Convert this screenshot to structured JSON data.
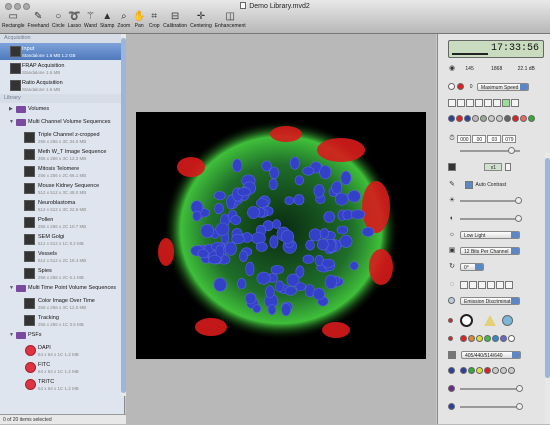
{
  "window": {
    "title": "Demo Library.mvd2"
  },
  "toolbar": [
    {
      "label": "Rectangle",
      "icon": "rectangle-icon"
    },
    {
      "label": "Freehand",
      "icon": "freehand-icon"
    },
    {
      "label": "Circle",
      "icon": "circle-icon"
    },
    {
      "label": "Lasso",
      "icon": "lasso-icon"
    },
    {
      "label": "Wand",
      "icon": "wand-icon"
    },
    {
      "label": "Stamp",
      "icon": "stamp-icon"
    },
    {
      "label": "Zoom",
      "icon": "zoom-icon"
    },
    {
      "label": "Pan",
      "icon": "pan-icon"
    },
    {
      "label": "Crop",
      "icon": "crop-icon"
    },
    {
      "label": "Calibration",
      "icon": "calibration-icon"
    },
    {
      "label": "Centering",
      "icon": "centering-icon"
    },
    {
      "label": "Enhancement",
      "icon": "enhancement-icon"
    }
  ],
  "sidebar": {
    "section_acq": "Acquisition",
    "acq_items": [
      {
        "name": "Input",
        "meta": "Standalone 1.6 MB 1.2 GB"
      },
      {
        "name": "FRAP Acquisition",
        "meta": "Standalone 1.6 MB"
      },
      {
        "name": "Ratio Acquisition",
        "meta": "Standalone 1.6 MB"
      }
    ],
    "section_lib": "Library",
    "groups": [
      {
        "name": "Volumes",
        "items": []
      },
      {
        "name": "Multi Channel Volume Sequences",
        "items": [
          {
            "name": "Triple Channel z-cropped",
            "meta": "256 x 256 x 3C 34.0 MB"
          },
          {
            "name": "Meth W_T Image Sequence",
            "meta": "256 x 256 x 3C 12.2 MB"
          },
          {
            "name": "Mitosis Telomere",
            "meta": "256 x 256 x 2C 66.1 MB"
          },
          {
            "name": "Mouse Kidney Sequence",
            "meta": "512 x 512 x 3C 48.0 MB"
          },
          {
            "name": "Neuroblastoma",
            "meta": "512 x 512 x 3C 22.6 MB"
          },
          {
            "name": "Pollen",
            "meta": "256 x 256 x 2C 10.7 MB"
          },
          {
            "name": "SEM Golgi",
            "meta": "512 x 512 x 1C 8.2 MB"
          },
          {
            "name": "Vessels",
            "meta": "512 x 512 x 2C 18.4 MB"
          },
          {
            "name": "Spies",
            "meta": "256 x 256 x 2C 6.1 MB"
          }
        ]
      },
      {
        "name": "Multi Time Point Volume Sequences",
        "items": [
          {
            "name": "Color Image Over Time",
            "meta": "256 x 256 x 3C 12.0 MB"
          },
          {
            "name": "Tracking",
            "meta": "256 x 256 x 1C 3.5 MB"
          }
        ]
      },
      {
        "name": "PSFs",
        "items": [
          {
            "name": "DAPI",
            "meta": "64 x 64 x 1C 1.2 MB"
          },
          {
            "name": "FITC",
            "meta": "64 x 64 x 1C 1.2 MB"
          },
          {
            "name": "TRITC",
            "meta": "64 x 64 x 1C 1.2 MB"
          }
        ]
      }
    ],
    "status": "0 of 20 items selected"
  },
  "panel": {
    "timecode": "17:33:56",
    "readout": [
      "145",
      "1868",
      "22.1 dB"
    ],
    "speed": "Maximum Speed",
    "speed_value": "0",
    "frame_fields": [
      "000",
      "00",
      "03",
      "079"
    ],
    "zoom": "x1",
    "auto_contrast": "Auto Contrast",
    "light_mode": "Low Light",
    "bit_depth": "12 Bits Per Channel",
    "rotation": "0°",
    "emission": "Emission Discriminat...",
    "filter_set": "405/440/514/640",
    "colors": {
      "accent": "#5d86c4",
      "lcd": "#c9dcc0",
      "selection": "#4f79bd"
    }
  }
}
